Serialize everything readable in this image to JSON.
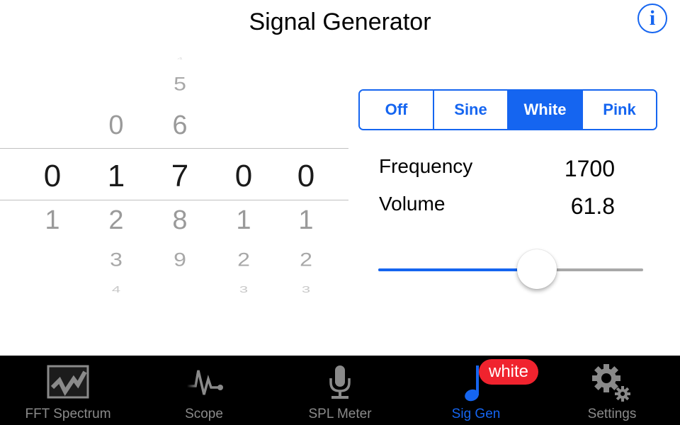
{
  "header": {
    "title": "Signal Generator",
    "info_icon": "info-icon",
    "info_glyph": "i"
  },
  "picker": {
    "selected": [
      "0",
      "1",
      "7",
      "0",
      "0"
    ],
    "columns": [
      {
        "above": [],
        "below": [
          "1"
        ]
      },
      {
        "above": [
          "0"
        ],
        "below": [
          "2",
          "3",
          "4"
        ]
      },
      {
        "above": [
          "4",
          "5",
          "6"
        ],
        "below": [
          "8",
          "9"
        ]
      },
      {
        "above": [],
        "below": [
          "1",
          "2",
          "3"
        ]
      },
      {
        "above": [],
        "below": [
          "1",
          "2",
          "3"
        ]
      }
    ]
  },
  "waveform": {
    "options": [
      "Off",
      "Sine",
      "White",
      "Pink"
    ],
    "selected": "White"
  },
  "readouts": {
    "frequency_label": "Frequency",
    "frequency_value": "1700",
    "volume_label": "Volume",
    "volume_value": "61.8"
  },
  "volume_slider": {
    "fraction": 0.6
  },
  "colors": {
    "accent": "#1565f0",
    "badge": "#f0232e",
    "tabbar_bg": "#000000",
    "inactive": "#8a8a8a"
  },
  "tabbar": {
    "tabs": [
      {
        "label": "FFT Spectrum",
        "icon": "spectrum-chart-icon",
        "active": false
      },
      {
        "label": "Scope",
        "icon": "pulse-waveform-icon",
        "active": false
      },
      {
        "label": "SPL Meter",
        "icon": "microphone-icon",
        "active": false
      },
      {
        "label": "Sig Gen",
        "icon": "music-note-icon",
        "active": true
      },
      {
        "label": "Settings",
        "icon": "gears-icon",
        "active": false
      }
    ],
    "badge": "white"
  }
}
